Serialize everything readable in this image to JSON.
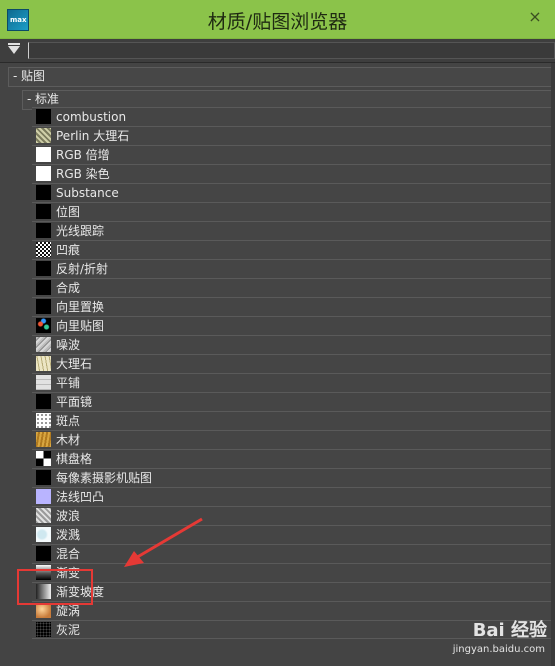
{
  "window": {
    "title": "材质/贴图浏览器",
    "close_glyph": "×",
    "app_icon_text": "max"
  },
  "search": {
    "value": ""
  },
  "tree": {
    "root_toggle": "-",
    "root_label": "贴图",
    "group_toggle": "-",
    "group_label": "标准",
    "items": [
      {
        "label": "combustion",
        "thumb": "t-black"
      },
      {
        "label": "Perlin 大理石",
        "thumb": "t-perlin"
      },
      {
        "label": "RGB 倍增",
        "thumb": "t-white"
      },
      {
        "label": "RGB 染色",
        "thumb": "t-white"
      },
      {
        "label": "Substance",
        "thumb": "t-black"
      },
      {
        "label": "位图",
        "thumb": "t-black"
      },
      {
        "label": "光线跟踪",
        "thumb": "t-black"
      },
      {
        "label": "凹痕",
        "thumb": "t-dent"
      },
      {
        "label": "反射/折射",
        "thumb": "t-black"
      },
      {
        "label": "合成",
        "thumb": "t-black"
      },
      {
        "label": "向里置换",
        "thumb": "t-black"
      },
      {
        "label": "向里贴图",
        "thumb": "t-vecmap"
      },
      {
        "label": "噪波",
        "thumb": "t-noise"
      },
      {
        "label": "大理石",
        "thumb": "t-marble"
      },
      {
        "label": "平铺",
        "thumb": "t-tile"
      },
      {
        "label": "平面镜",
        "thumb": "t-black"
      },
      {
        "label": "斑点",
        "thumb": "t-speckle"
      },
      {
        "label": "木材",
        "thumb": "t-wood"
      },
      {
        "label": "棋盘格",
        "thumb": "t-checker"
      },
      {
        "label": "每像素摄影机贴图",
        "thumb": "t-black"
      },
      {
        "label": "法线凹凸",
        "thumb": "t-lavender"
      },
      {
        "label": "波浪",
        "thumb": "t-waves"
      },
      {
        "label": "泼溅",
        "thumb": "t-splash"
      },
      {
        "label": "混合",
        "thumb": "t-black"
      },
      {
        "label": "渐变",
        "thumb": "t-gradient"
      },
      {
        "label": "渐变坡度",
        "thumb": "t-gradramp"
      },
      {
        "label": "旋涡",
        "thumb": "t-swirl"
      },
      {
        "label": "灰泥",
        "thumb": "t-smoke"
      }
    ]
  },
  "annotation": {
    "highlight_color": "#e53935"
  },
  "watermark": {
    "logo": "Bai 经验",
    "url": "jingyan.baidu.com"
  },
  "colors": {
    "titlebar": "#8bc34a",
    "panel": "#444444"
  }
}
